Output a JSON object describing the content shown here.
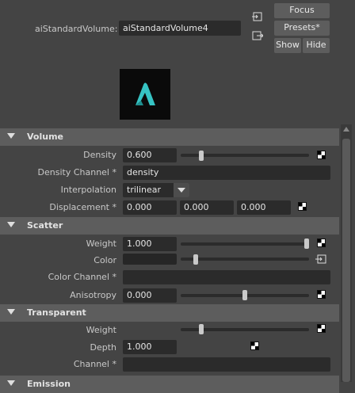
{
  "header": {
    "node_label": "aiStandardVolume:",
    "node_name": "aiStandardVolume4",
    "buttons": {
      "focus": "Focus",
      "presets": "Presets*",
      "show": "Show",
      "hide": "Hide"
    }
  },
  "sections": {
    "volume": {
      "title": "Volume",
      "density_label": "Density",
      "density_value": "0.600",
      "density_slider": 0.15,
      "density_channel_label": "Density Channel *",
      "density_channel_value": "density",
      "interpolation_label": "Interpolation",
      "interpolation_value": "trilinear",
      "displacement_label": "Displacement *",
      "displacement_values": [
        "0.000",
        "0.000",
        "0.000"
      ]
    },
    "scatter": {
      "title": "Scatter",
      "weight_label": "Weight",
      "weight_value": "1.000",
      "weight_slider": 1.0,
      "color_label": "Color",
      "color_slider": 0.1,
      "color_channel_label": "Color Channel *",
      "anisotropy_label": "Anisotropy",
      "anisotropy_value": "0.000",
      "anisotropy_slider": 0.5
    },
    "transparent": {
      "title": "Transparent",
      "weight_label": "Weight",
      "weight_slider": 0.15,
      "depth_label": "Depth",
      "depth_value": "1.000",
      "channel_label": "Channel *"
    },
    "emission": {
      "title": "Emission"
    }
  },
  "colors": {
    "accent_logo": "#36c3c3",
    "field_bg": "#2b2b2b",
    "frame_bg": "#5d5d5d"
  }
}
